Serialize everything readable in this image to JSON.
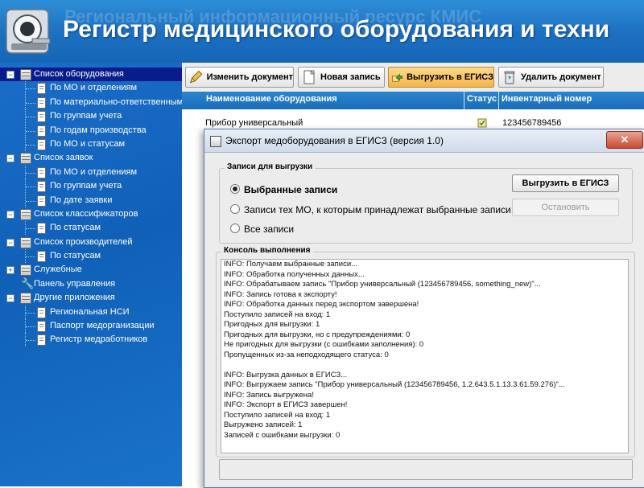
{
  "header": {
    "ghost_text": "Региональный информационный ресурс КМИС",
    "title": "Регистр медицинского оборудования и техни"
  },
  "sidebar": {
    "items": [
      {
        "label": "Список оборудования",
        "level": 0,
        "icon": "cabinet-icon",
        "selected": true
      },
      {
        "label": "По МО и отделениям",
        "level": 1,
        "icon": "document-icon"
      },
      {
        "label": "По материально-ответственным л",
        "level": 1,
        "icon": "document-icon"
      },
      {
        "label": "По группам учета",
        "level": 1,
        "icon": "document-icon"
      },
      {
        "label": "По годам производства",
        "level": 1,
        "icon": "document-icon"
      },
      {
        "label": "По МО и статусам",
        "level": 1,
        "icon": "document-icon"
      },
      {
        "label": "Список заявок",
        "level": 0,
        "icon": "cabinet-icon"
      },
      {
        "label": "По МО и отделениям",
        "level": 1,
        "icon": "document-icon"
      },
      {
        "label": "По группам учета",
        "level": 1,
        "icon": "document-icon"
      },
      {
        "label": "По дате заявки",
        "level": 1,
        "icon": "document-icon"
      },
      {
        "label": "Список классификаторов",
        "level": 0,
        "icon": "cabinet-icon"
      },
      {
        "label": "По статусам",
        "level": 1,
        "icon": "document-icon"
      },
      {
        "label": "Список производителей",
        "level": 0,
        "icon": "cabinet-icon"
      },
      {
        "label": "По статусам",
        "level": 1,
        "icon": "document-icon"
      },
      {
        "label": "Служебные",
        "level": 0,
        "icon": "cabinet-icon"
      },
      {
        "label": "Панель управления",
        "level": 0,
        "icon": "wrench-icon"
      },
      {
        "label": "Другие приложения",
        "level": 0,
        "icon": "cabinet-icon"
      },
      {
        "label": "Региональная НСИ",
        "level": 1,
        "icon": "document-icon"
      },
      {
        "label": "Паспорт медорганизации",
        "level": 1,
        "icon": "document-icon"
      },
      {
        "label": "Регистр медработников",
        "level": 1,
        "icon": "document-icon"
      }
    ]
  },
  "toolbar": {
    "edit_label": "Изменить документ",
    "new_label": "Новая запись",
    "export_label": "Выгрузить в ЕГИСЗ",
    "delete_label": "Удалить документ"
  },
  "grid": {
    "columns": [
      "Наименование оборудования",
      "Статус",
      "Инвентарный номер"
    ],
    "rows": [
      {
        "name": "Прибор универсальный",
        "status_icon": "status-icon",
        "inventory": "123456789456"
      }
    ]
  },
  "dialog": {
    "title": "Экспорт медоборудования в ЕГИСЗ (версия 1.0)",
    "close_symbol": "✕",
    "records_group_label": "Записи для выгрузки",
    "options": [
      {
        "label": "Выбранные записи",
        "checked": true
      },
      {
        "label": "Записи тех МО, к которым принадлежат выбранные записи",
        "checked": false
      },
      {
        "label": "Все записи",
        "checked": false
      }
    ],
    "export_button": "Выгрузить в ЕГИСЗ",
    "stop_button": "Остановить",
    "console_group_label": "Консоль выполнения",
    "console_lines": [
      "INFO: Получаем выбранные записи...",
      "INFO: Обработка полученных данных...",
      "INFO: Обрабатываем запись \"Прибор универсальный (123456789456, something_new)\"...",
      "INFO: Запись готова к экспорту!",
      "INFO: Обработка данных перед экспортом завершена!",
      "Поступило записей на вход: 1",
      "Пригодных для выгрузки: 1",
      "Пригодных для выгрузки, но с предупреждениями: 0",
      "Не пригодных для выгрузки (с ошибками заполнения): 0",
      "Пропущенных из-за неподходящего статуса: 0",
      "",
      "INFO: Выгрузка данных в ЕГИСЗ...",
      "INFO: Выгружаем запись \"Прибор универсальный (123456789456, 1.2.643.5.1.13.3.61.59.276)\"...",
      "INFO: Запись выгружена!",
      "INFO: Экспорт в ЕГИСЗ завершен!",
      "Поступило записей на вход: 1",
      "Выгружено записей: 1",
      "Записей с ошибками выгрузки: 0"
    ]
  },
  "colors": {
    "header_blue": "#1c6fc0",
    "sidebar_blue": "#1060b8",
    "selected_node": "#0a1c8c",
    "grid_header": "#2a86cf",
    "export_button_orange": "#f4b548"
  }
}
